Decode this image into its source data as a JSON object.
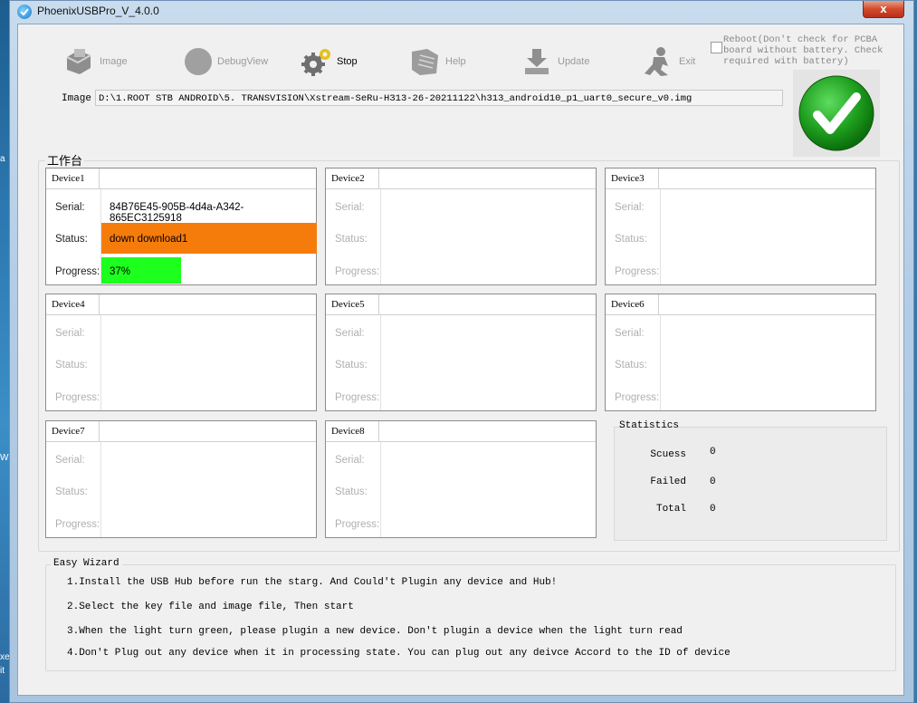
{
  "desktop": {
    "edge_letters": [
      "a",
      "W",
      "xe",
      "it"
    ]
  },
  "window": {
    "title": "PhoenixUSBPro_V_4.0.0",
    "close_glyph": "x"
  },
  "toolbar": {
    "items": [
      {
        "label": "Image",
        "icon": "image-file-icon",
        "enabled": false
      },
      {
        "label": "DebugView",
        "icon": "debug-circle-icon",
        "enabled": false
      },
      {
        "label": "Stop",
        "icon": "gears-icon",
        "enabled": true
      },
      {
        "label": "Help",
        "icon": "help-book-icon",
        "enabled": false
      },
      {
        "label": "Update",
        "icon": "download-arrow-icon",
        "enabled": false
      },
      {
        "label": "Exit",
        "icon": "running-man-icon",
        "enabled": false
      }
    ],
    "reboot_label": "Reboot(Don't check for PCBA board without battery. Check required with battery)",
    "reboot_checked": false
  },
  "image": {
    "label": "Image",
    "path": "D:\\1.ROOT STB ANDROID\\5. TRANSVISION\\Xstream-SeRu-H313-26-20211122\\h313_android10_p1_uart0_secure_v0.img"
  },
  "status_light": {
    "state": "ok",
    "icon": "green-check-icon",
    "color": "#1fa01f"
  },
  "workbench": {
    "title": "工作台",
    "row_labels": {
      "serial": "Serial:",
      "status": "Status:",
      "progress": "Progress:"
    },
    "devices": [
      {
        "name": "Device1",
        "serial": "84B76E45-905B-4d4a-A342-865EC3125918",
        "status": "down download1",
        "progress": "37%",
        "progress_fraction": 0.37,
        "status_color": "#f57c0b",
        "progress_color": "#1dff1d"
      },
      {
        "name": "Device2"
      },
      {
        "name": "Device3"
      },
      {
        "name": "Device4"
      },
      {
        "name": "Device5"
      },
      {
        "name": "Device6"
      },
      {
        "name": "Device7"
      },
      {
        "name": "Device8"
      }
    ]
  },
  "statistics": {
    "title": "Statistics",
    "rows": [
      {
        "label": "Scuess",
        "value": "0"
      },
      {
        "label": "Failed",
        "value": "0"
      },
      {
        "label": "Total",
        "value": "0"
      }
    ]
  },
  "wizard": {
    "title": "Easy Wizard",
    "lines": [
      "1.Install the USB Hub before run the starg. And Could't Plugin any device and Hub!",
      "2.Select the key file and image file, Then start",
      "3.When the light turn green, please plugin a new device. Don't plugin a device when the light turn read",
      "4.Don't Plug out any device when it in processing state. You can plug out any deivce Accord to the ID of device"
    ]
  }
}
